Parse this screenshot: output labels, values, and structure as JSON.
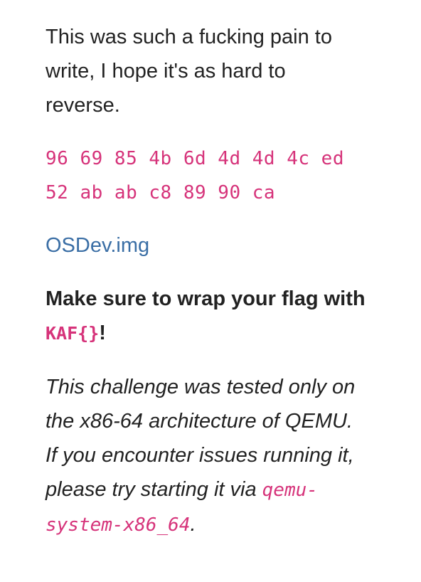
{
  "intro": {
    "line1": "This was such a fucking pain to",
    "line2": "write, I hope it's as hard to",
    "line3": "reverse."
  },
  "hex": {
    "line1": "96 69 85 4b 6d 4d 4d 4c ed",
    "line2": "52 ab ab c8 89 90 ca"
  },
  "download": {
    "label": "OSDev.img"
  },
  "instruction": {
    "line1": "Make sure to wrap your flag with",
    "flag_format": "KAF{}",
    "suffix": "!"
  },
  "note": {
    "line1": "This challenge was tested only on",
    "line2": "the x86-64 architecture of QEMU.",
    "line3": "If you encounter issues running it,",
    "line4_prefix": "please try starting it via ",
    "cmd_part1": "qemu-",
    "cmd_part2": "system-x86_64",
    "end": "."
  },
  "colors": {
    "text": "#222222",
    "code": "#d6337a",
    "link": "#3a6ea5",
    "background": "#ffffff"
  }
}
